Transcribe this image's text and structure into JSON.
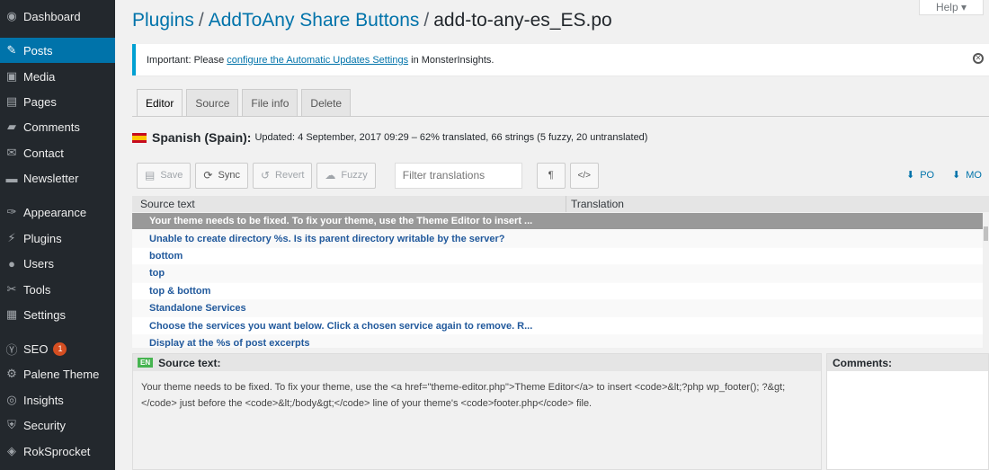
{
  "sidebar": {
    "items": [
      {
        "label": "Dashboard",
        "icon": "dashboard-icon",
        "glyph": "◉",
        "active": false
      },
      {
        "label": "Posts",
        "icon": "pin-icon",
        "glyph": "✎",
        "active": true
      },
      {
        "label": "Media",
        "icon": "media-icon",
        "glyph": "▣",
        "active": false
      },
      {
        "label": "Pages",
        "icon": "pages-icon",
        "glyph": "▤",
        "active": false
      },
      {
        "label": "Comments",
        "icon": "comments-icon",
        "glyph": "▰",
        "active": false
      },
      {
        "label": "Contact",
        "icon": "envelope-icon",
        "glyph": "✉",
        "active": false
      },
      {
        "label": "Newsletter",
        "icon": "newsletter-icon",
        "glyph": "▬",
        "active": false
      },
      {
        "label": "Appearance",
        "icon": "brush-icon",
        "glyph": "✑",
        "active": false
      },
      {
        "label": "Plugins",
        "icon": "plug-icon",
        "glyph": "⚡",
        "active": false
      },
      {
        "label": "Users",
        "icon": "users-icon",
        "glyph": "●",
        "active": false
      },
      {
        "label": "Tools",
        "icon": "wrench-icon",
        "glyph": "✂",
        "active": false
      },
      {
        "label": "Settings",
        "icon": "settings-icon",
        "glyph": "▦",
        "active": false
      },
      {
        "label": "SEO",
        "icon": "yoast-icon",
        "glyph": "Ⓨ",
        "active": false,
        "badge": "1"
      },
      {
        "label": "Palene Theme",
        "icon": "gear-icon",
        "glyph": "⚙",
        "active": false
      },
      {
        "label": "Insights",
        "icon": "insights-icon",
        "glyph": "◎",
        "active": false
      },
      {
        "label": "Security",
        "icon": "shield-icon",
        "glyph": "⛨",
        "active": false
      },
      {
        "label": "RokSprocket",
        "icon": "rocket-icon",
        "glyph": "◈",
        "active": false
      }
    ]
  },
  "header": {
    "crumb1": "Plugins",
    "crumb2": "AddToAny Share Buttons",
    "crumb3": "add-to-any-es_ES.po",
    "separator": "/",
    "help": "Help ▾"
  },
  "notice": {
    "prefix": "Important: Please ",
    "link": "configure the Automatic Updates Settings",
    "suffix": " in MonsterInsights.",
    "close_glyph": "✕"
  },
  "tabs": [
    "Editor",
    "Source",
    "File info",
    "Delete"
  ],
  "language": {
    "name": "Spanish (Spain):",
    "meta": "Updated: 4 September, 2017 09:29 – 62% translated, 66 strings (5 fuzzy, 20 untranslated)"
  },
  "toolbar": {
    "save": "Save",
    "sync": "Sync",
    "revert": "Revert",
    "fuzzy": "Fuzzy",
    "filter_placeholder": "Filter translations",
    "pilcrow": "¶",
    "code": "</>",
    "po": "PO",
    "mo": "MO"
  },
  "table": {
    "col_source": "Source text",
    "col_translation": "Translation",
    "rows": [
      "Your theme needs to be fixed. To fix your theme, use the Theme Editor to insert ...",
      "Unable to create directory %s. Is its parent directory writable by the server?",
      "bottom",
      "top",
      "top & bottom",
      "Standalone Services",
      "Choose the services you want below.  Click a chosen service again to remove.  R...",
      "Display at the %s of post excerpts"
    ],
    "selected_index": 0
  },
  "source_panel": {
    "badge": "EN",
    "title": "Source text:",
    "text": "Your theme needs to be fixed. To fix your theme, use the <a href=\"theme-editor.php\">Theme Editor</a> to insert <code>&lt;?php wp_footer(); ?&gt;</code> just before the <code>&lt;/body&gt;</code> line of your theme's <code>footer.php</code> file."
  },
  "comments_panel": {
    "title": "Comments:"
  },
  "colors": {
    "sidebar_bg": "#23282d",
    "accent": "#0073aa",
    "selected_row": "#999999",
    "link_text": "#21599c"
  }
}
